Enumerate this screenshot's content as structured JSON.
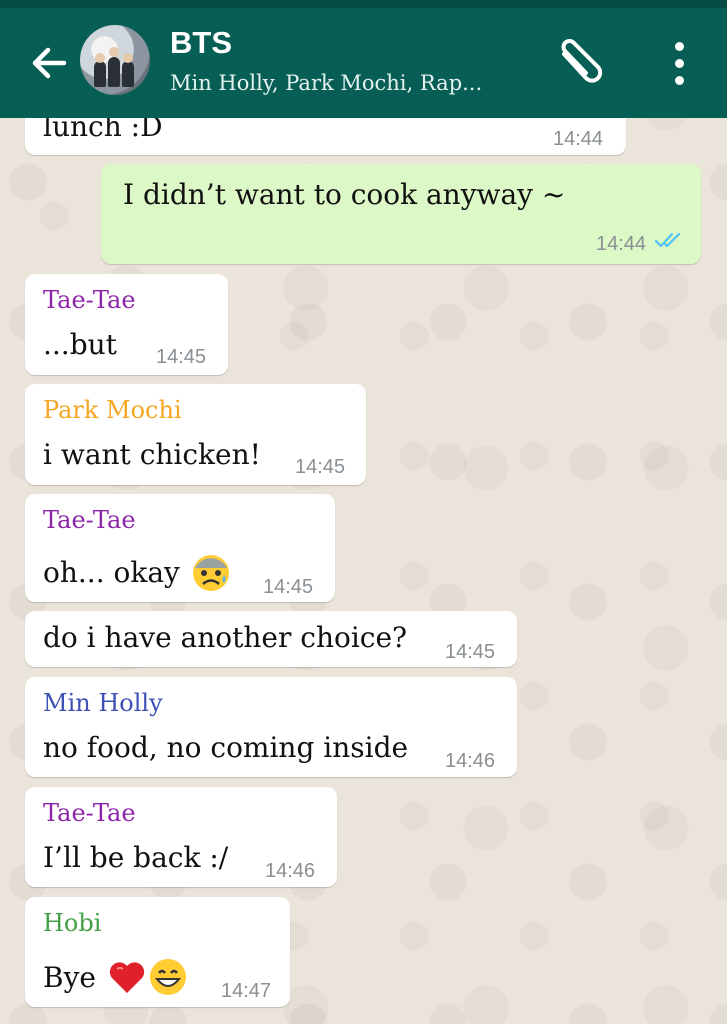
{
  "header": {
    "title": "BTS",
    "subtitle": "Min Holly, Park Mochi, Rap...",
    "back_icon": "arrow-left-icon",
    "attach_icon": "paperclip-icon",
    "menu_icon": "more-vert-icon",
    "background_color": "#075e54"
  },
  "messages": [
    {
      "direction": "in",
      "sender": "",
      "text": "lunch :D",
      "time": "14:44"
    },
    {
      "direction": "out",
      "sender": "",
      "text": "I didn’t want to cook anyway ~",
      "time": "14:44",
      "status": "read"
    },
    {
      "direction": "in",
      "sender": "Tae-Tae",
      "sender_color": "#8e24aa",
      "text": "...but",
      "time": "14:45"
    },
    {
      "direction": "in",
      "sender": "Park Mochi",
      "sender_color": "#f5a623",
      "text": "i want chicken!",
      "time": "14:45"
    },
    {
      "direction": "in",
      "sender": "Tae-Tae",
      "sender_color": "#8e24aa",
      "text": "oh... okay",
      "emoji": "anxious-face-icon",
      "time": "14:45"
    },
    {
      "direction": "in",
      "sender": "",
      "text": "do i have another choice?",
      "time": "14:45"
    },
    {
      "direction": "in",
      "sender": "Min Holly",
      "sender_color": "#3f51b5",
      "text": "no food, no coming inside",
      "time": "14:46"
    },
    {
      "direction": "in",
      "sender": "Tae-Tae",
      "sender_color": "#8e24aa",
      "text": "I’ll be back :/",
      "time": "14:46"
    },
    {
      "direction": "in",
      "sender": "Hobi",
      "sender_color": "#43a047",
      "text": "Bye",
      "emoji": "heart-and-grin-icons",
      "time": "14:47"
    }
  ],
  "colors": {
    "incoming_bubble": "#ffffff",
    "outgoing_bubble": "#dcf8c6",
    "read_ticks": "#4fc3f7"
  }
}
